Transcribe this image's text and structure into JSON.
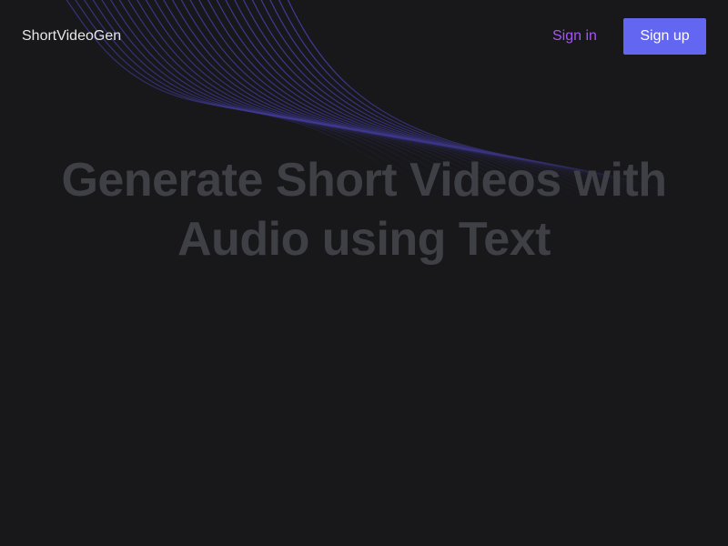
{
  "header": {
    "brand": "ShortVideoGen",
    "sign_in_label": "Sign in",
    "sign_up_label": "Sign up"
  },
  "hero": {
    "title_line1": "Generate Short Videos with",
    "title_line2": "Audio using Text"
  },
  "colors": {
    "background": "#18181b",
    "brand_text": "#e5e7eb",
    "sign_in_text": "#a855f7",
    "sign_up_bg": "#6366f1",
    "hero_text": "#3f3f46",
    "wave_lines": "#4c45a8"
  },
  "decoration": {
    "background_pattern": "wave-lines"
  }
}
